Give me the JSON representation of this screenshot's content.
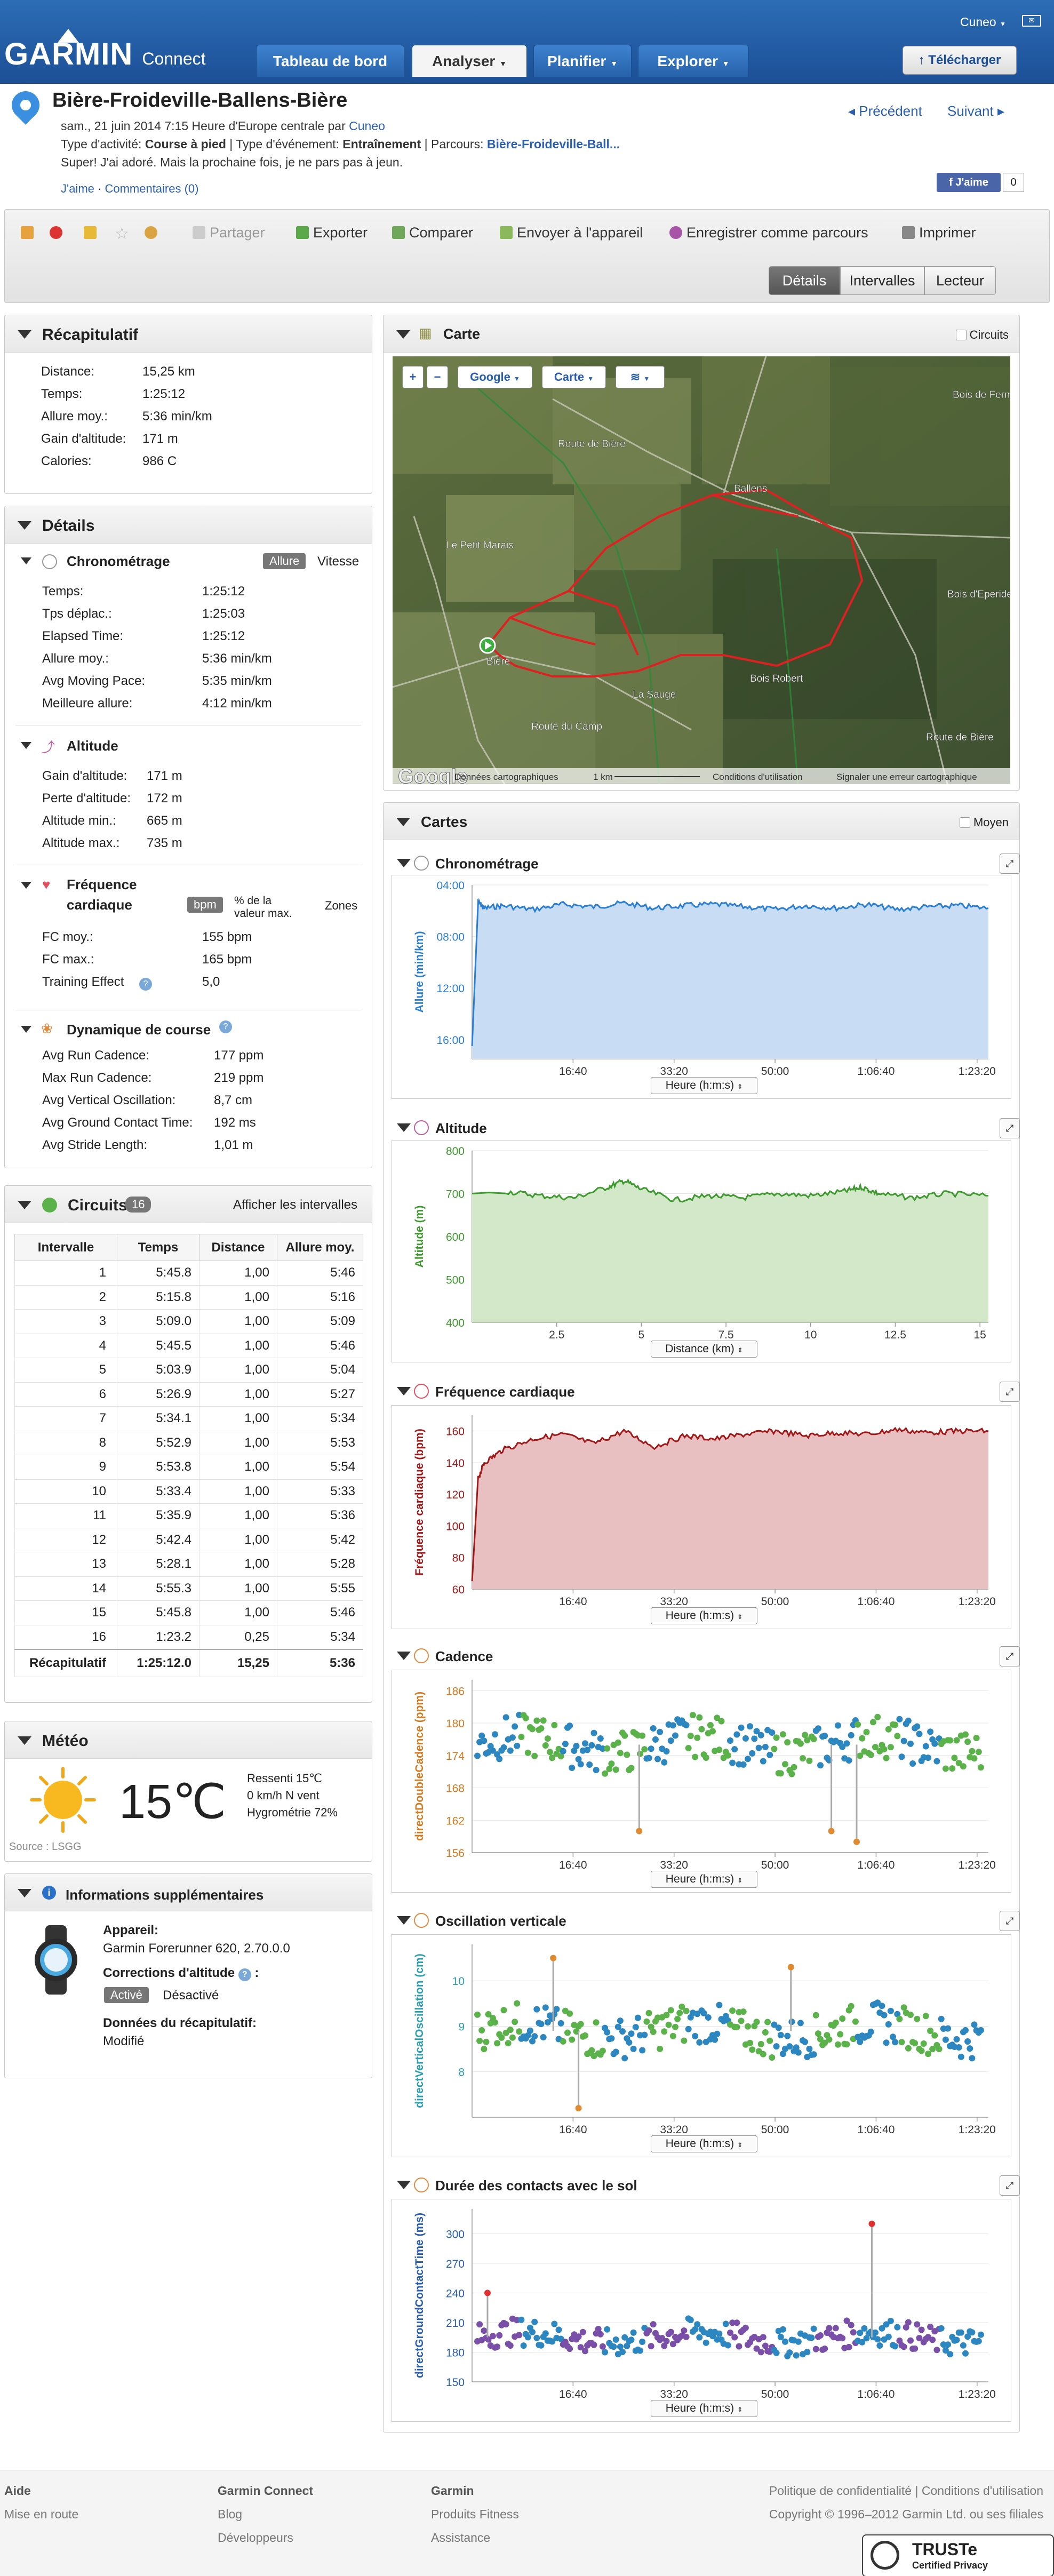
{
  "nav": {
    "logo_main": "GARMIN",
    "logo_sub": "Connect",
    "tabs": [
      "Tableau de bord",
      "Analyser",
      "Planifier",
      "Explorer"
    ],
    "user": "Cuneo",
    "upload": "Télécharger"
  },
  "activity": {
    "title": "Bière-Froideville-Ballens-Bière",
    "date_line": "sam., 21 juin 2014 7:15 Heure d'Europe centrale par",
    "author": "Cuneo",
    "type_label": "Type d'activité:",
    "type_value": "Course à pied",
    "event_label": "Type d'événement:",
    "event_value": "Entraînement",
    "course_label": "Parcours:",
    "course_value": "Bière-Froideville-Ball...",
    "description": "Super! J'ai adoré. Mais la prochaine fois, je ne pars pas à jeun.",
    "like_link": "J'aime",
    "comments_link": "Commentaires (0)",
    "prev": "Précédent",
    "next": "Suivant",
    "fb_like": "J'aime",
    "fb_count": "0"
  },
  "toolbar": {
    "share": "Partager",
    "export": "Exporter",
    "compare": "Comparer",
    "send": "Envoyer à l'appareil",
    "save_course": "Enregistrer comme parcours",
    "print": "Imprimer",
    "views": [
      "Détails",
      "Intervalles",
      "Lecteur"
    ]
  },
  "summary": {
    "title": "Récapitulatif",
    "rows": [
      {
        "k": "Distance:",
        "v": "15,25 km"
      },
      {
        "k": "Temps:",
        "v": "1:25:12"
      },
      {
        "k": "Allure moy.:",
        "v": "5:36 min/km"
      },
      {
        "k": "Gain d'altitude:",
        "v": "171 m"
      },
      {
        "k": "Calories:",
        "v": "986 C"
      }
    ]
  },
  "details": {
    "title": "Détails",
    "timing": {
      "title": "Chronométrage",
      "toggle_on": "Allure",
      "toggle_off": "Vitesse",
      "rows": [
        {
          "k": "Temps:",
          "v": "1:25:12"
        },
        {
          "k": "Tps déplac.:",
          "v": "1:25:03"
        },
        {
          "k": "Elapsed Time:",
          "v": "1:25:12"
        },
        {
          "k": "Allure moy.:",
          "v": "5:36 min/km"
        },
        {
          "k": "Avg Moving Pace:",
          "v": "5:35 min/km"
        },
        {
          "k": "Meilleure allure:",
          "v": "4:12 min/km"
        }
      ]
    },
    "altitude": {
      "title": "Altitude",
      "rows": [
        {
          "k": "Gain d'altitude:",
          "v": "171 m"
        },
        {
          "k": "Perte d'altitude:",
          "v": "172 m"
        },
        {
          "k": "Altitude min.:",
          "v": "665 m"
        },
        {
          "k": "Altitude max.:",
          "v": "735 m"
        }
      ]
    },
    "heart": {
      "title_1": "Fréquence",
      "title_2": "cardiaque",
      "unit_on": "bpm",
      "unit_pct_1": "% de la",
      "unit_pct_2": "valeur max.",
      "zones": "Zones",
      "rows": [
        {
          "k": "FC moy.:",
          "v": "155 bpm"
        },
        {
          "k": "FC max.:",
          "v": "165 bpm"
        },
        {
          "k": "Training Effect",
          "v": "5,0"
        }
      ]
    },
    "dynamics": {
      "title": "Dynamique de course",
      "rows": [
        {
          "k": "Avg Run Cadence:",
          "v": "177 ppm"
        },
        {
          "k": "Max Run Cadence:",
          "v": "219 ppm"
        },
        {
          "k": "Avg Vertical Oscillation:",
          "v": "8,7 cm"
        },
        {
          "k": "Avg Ground Contact Time:",
          "v": "192 ms"
        },
        {
          "k": "Avg Stride Length:",
          "v": "1,01 m"
        }
      ]
    }
  },
  "laps": {
    "title": "Circuits",
    "count": "16",
    "show": "Afficher les intervalles",
    "headers": [
      "Intervalle",
      "Temps",
      "Distance",
      "Allure moy."
    ],
    "rows": [
      [
        "1",
        "5:45.8",
        "1,00",
        "5:46"
      ],
      [
        "2",
        "5:15.8",
        "1,00",
        "5:16"
      ],
      [
        "3",
        "5:09.0",
        "1,00",
        "5:09"
      ],
      [
        "4",
        "5:45.5",
        "1,00",
        "5:46"
      ],
      [
        "5",
        "5:03.9",
        "1,00",
        "5:04"
      ],
      [
        "6",
        "5:26.9",
        "1,00",
        "5:27"
      ],
      [
        "7",
        "5:34.1",
        "1,00",
        "5:34"
      ],
      [
        "8",
        "5:52.9",
        "1,00",
        "5:53"
      ],
      [
        "9",
        "5:53.8",
        "1,00",
        "5:54"
      ],
      [
        "10",
        "5:33.4",
        "1,00",
        "5:33"
      ],
      [
        "11",
        "5:35.9",
        "1,00",
        "5:36"
      ],
      [
        "12",
        "5:42.4",
        "1,00",
        "5:42"
      ],
      [
        "13",
        "5:28.1",
        "1,00",
        "5:28"
      ],
      [
        "14",
        "5:55.3",
        "1,00",
        "5:55"
      ],
      [
        "15",
        "5:45.8",
        "1,00",
        "5:46"
      ],
      [
        "16",
        "1:23.2",
        "0,25",
        "5:34"
      ]
    ],
    "total": [
      "Récapitulatif",
      "1:25:12.0",
      "15,25",
      "5:36"
    ]
  },
  "weather": {
    "title": "Météo",
    "temp": "15℃",
    "feels": "Ressenti 15℃",
    "wind": "0 km/h N vent",
    "humidity": "Hygrométrie 72%",
    "source": "Source : LSGG"
  },
  "device": {
    "title": "Informations supplémentaires",
    "device_label": "Appareil:",
    "device_value": "Garmin Forerunner 620, 2.70.0.0",
    "corr_label": "Corrections d'altitude",
    "corr_on": "Activé",
    "corr_off": "Désactivé",
    "summary_label": "Données du récapitulatif:",
    "summary_value": "Modifié"
  },
  "map": {
    "title": "Carte",
    "circuits": "Circuits",
    "google": "Google",
    "maptype": "Carte",
    "labels": [
      "Bois de Fermens",
      "Ballens",
      "Bois d'Eperides",
      "Bois Robert",
      "La Sauge",
      "Bière",
      "Route du Camp",
      "Route de Bière",
      "Le Petit Marais",
      "Route de Bière"
    ],
    "attrib": [
      "Données cartographiques",
      "1 km",
      "Conditions d'utilisation",
      "Signaler une erreur cartographique"
    ],
    "google_logo": "Google"
  },
  "charts_section": {
    "title": "Cartes",
    "moyen": "Moyen"
  },
  "colors": {
    "nav": "#1c4f96",
    "pace": "#2a7fd4",
    "altitude": "#3e9a2e",
    "heart": "#a01818",
    "cadence_a": "#2c86c0",
    "cadence_b": "#5cb24a",
    "gct_a": "#7a4fa8",
    "gct_b": "#2c86c0"
  },
  "chart_data": [
    {
      "type": "area",
      "title": "Chronométrage",
      "ylabel": "Allure (min/km)",
      "ylim": [
        17.5,
        4
      ],
      "yticks": [
        "04:00",
        "08:00",
        "12:00",
        "16:00"
      ],
      "xticks": [
        "16:40",
        "33:20",
        "50:00",
        "1:06:40",
        "1:23:20"
      ],
      "xselect": "Heure (h:m:s)",
      "x": [
        0,
        60,
        120,
        300,
        600,
        900,
        1200,
        1500,
        1800,
        2100,
        2400,
        2700,
        3000,
        3300,
        3600,
        3900,
        4200,
        4500,
        4800,
        5100
      ],
      "series": [
        {
          "values": [
            16.5,
            5.3,
            5.8,
            5.6,
            5.9,
            5.5,
            5.7,
            5.4,
            5.8,
            5.6,
            5.5,
            5.7,
            5.9,
            5.6,
            5.8,
            5.5,
            5.9,
            5.7,
            5.6,
            5.8
          ]
        }
      ]
    },
    {
      "type": "area",
      "title": "Altitude",
      "ylabel": "Altitude (m)",
      "ylim": [
        400,
        800
      ],
      "yticks": [
        "400",
        "500",
        "600",
        "700",
        "800"
      ],
      "xticks": [
        "2.5",
        "5",
        "7.5",
        "10",
        "12.5",
        "15"
      ],
      "xselect": "Distance (km)",
      "x": [
        0,
        1,
        2,
        3,
        4,
        4.5,
        5,
        6,
        7,
        8,
        9,
        10,
        11,
        11.5,
        12,
        13,
        14,
        15.25
      ],
      "series": [
        {
          "values": [
            700,
            705,
            695,
            690,
            715,
            730,
            710,
            685,
            695,
            690,
            700,
            695,
            705,
            715,
            700,
            690,
            700,
            695
          ]
        }
      ]
    },
    {
      "type": "area",
      "title": "Fréquence cardiaque",
      "ylabel": "Fréquence cardiaque (bpm)",
      "ylim": [
        60,
        170
      ],
      "yticks": [
        "60",
        "80",
        "100",
        "120",
        "140",
        "160"
      ],
      "xticks": [
        "16:40",
        "33:20",
        "50:00",
        "1:06:40",
        "1:23:20"
      ],
      "xselect": "Heure (h:m:s)",
      "x": [
        0,
        60,
        120,
        300,
        600,
        900,
        1200,
        1500,
        1800,
        2100,
        2400,
        2700,
        3000,
        3300,
        3600,
        3900,
        4200,
        4500,
        4800,
        5100
      ],
      "series": [
        {
          "values": [
            65,
            130,
            140,
            148,
            155,
            158,
            152,
            160,
            150,
            157,
            155,
            158,
            160,
            157,
            159,
            158,
            161,
            159,
            160,
            160
          ]
        }
      ]
    },
    {
      "type": "scatter",
      "title": "Cadence",
      "ylabel": "directDoubleCadence (ppm)",
      "ylim": [
        156,
        188
      ],
      "yticks": [
        "156",
        "162",
        "168",
        "174",
        "180",
        "186"
      ],
      "xticks": [
        "16:40",
        "33:20",
        "50:00",
        "1:06:40",
        "1:23:20"
      ],
      "xselect": "Heure (h:m:s)"
    },
    {
      "type": "scatter",
      "title": "Oscillation verticale",
      "ylabel": "directVerticalOscillation (cm)",
      "ylim": [
        7,
        10.8
      ],
      "yticks": [
        "8",
        "9",
        "10"
      ],
      "xticks": [
        "16:40",
        "33:20",
        "50:00",
        "1:06:40",
        "1:23:20"
      ],
      "xselect": "Heure (h:m:s)"
    },
    {
      "type": "scatter",
      "title": "Durée des contacts avec le sol",
      "ylabel": "directGroundContactTime (ms)",
      "ylim": [
        150,
        325
      ],
      "yticks": [
        "150",
        "180",
        "210",
        "240",
        "270",
        "300"
      ],
      "xticks": [
        "16:40",
        "33:20",
        "50:00",
        "1:06:40",
        "1:23:20"
      ],
      "xselect": "Heure (h:m:s)"
    }
  ],
  "footer": {
    "col1": [
      "Aide",
      "Mise en route"
    ],
    "col2": [
      "Garmin Connect",
      "Blog",
      "Développeurs"
    ],
    "col3": [
      "Garmin",
      "Produits Fitness",
      "Assistance"
    ],
    "policy": "Politique de confidentialité | Conditions d'utilisation",
    "copyright": "Copyright © 1996–2012 Garmin Ltd. ou ses filiales",
    "truste": "TRUSTe",
    "truste_sub": "Certified Privacy"
  }
}
